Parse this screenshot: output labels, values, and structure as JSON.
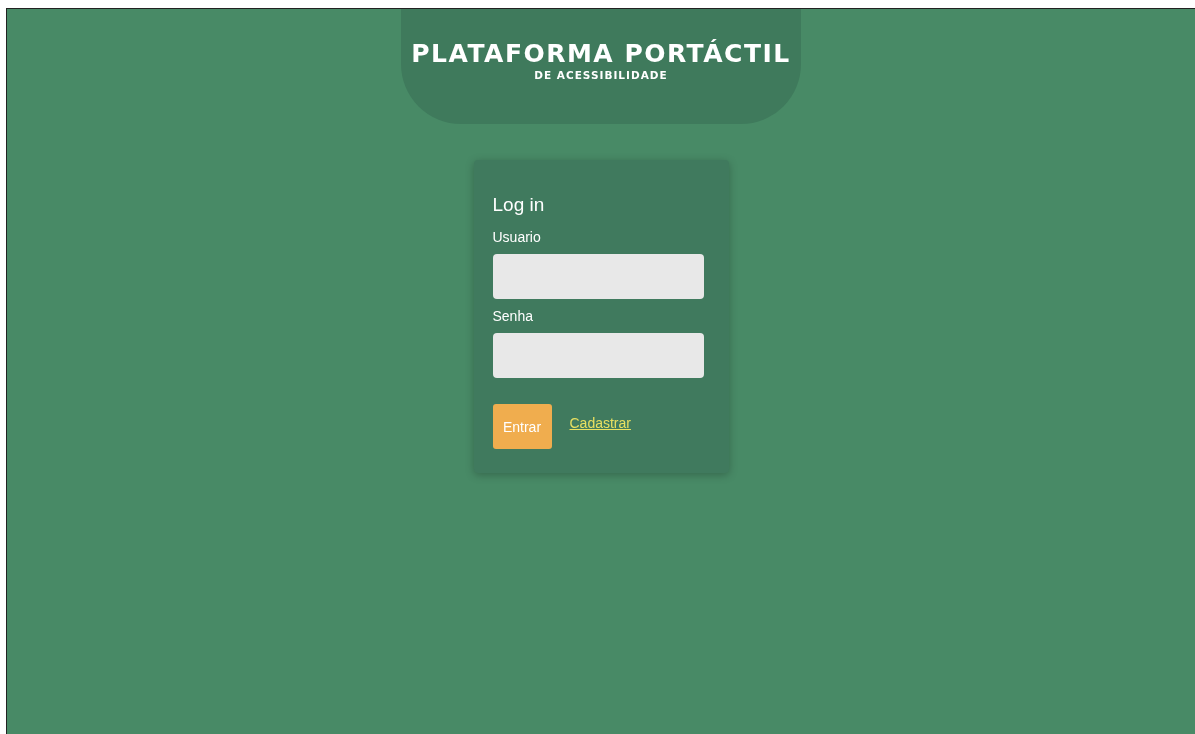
{
  "header": {
    "title": "PLATAFORMA PORTÁCTIL",
    "subtitle": "DE ACESSIBILIDADE"
  },
  "login": {
    "heading": "Log in",
    "fields": [
      {
        "label": "Usuario"
      },
      {
        "label": "Senha"
      }
    ],
    "submit": "Entrar",
    "register_link": "Cadastrar"
  }
}
